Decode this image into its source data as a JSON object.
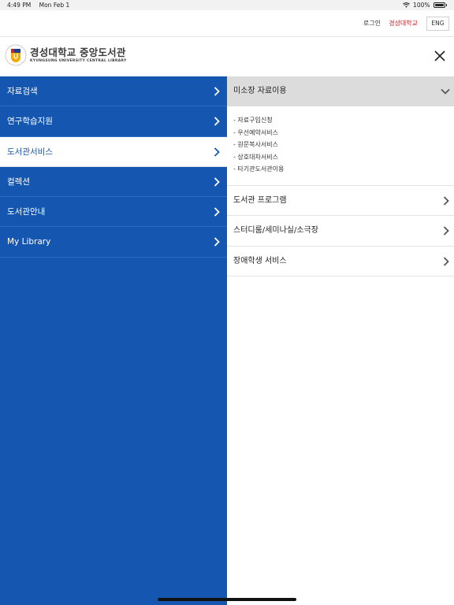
{
  "status_bar": {
    "time": "4:49 PM",
    "date": "Mon Feb 1",
    "battery": "100%",
    "icons": [
      "wifi-icon",
      "battery-icon"
    ]
  },
  "util_bar": {
    "login": "로그인",
    "university": "경성대학교",
    "language": "ENG"
  },
  "header": {
    "logo_ko": "경성대학교 중앙도서관",
    "logo_en": "KYUNGSUNG UNIVERSITY  CENTRAL LIBRARY",
    "close_icon": "close-icon"
  },
  "left_nav": {
    "items": [
      {
        "label": "자료검색"
      },
      {
        "label": "연구학습지원"
      },
      {
        "label": "도서관서비스"
      },
      {
        "label": "컬렉션"
      },
      {
        "label": "도서관안내"
      },
      {
        "label": "My Library"
      }
    ],
    "active_index": 2
  },
  "right_panel": {
    "expanded": {
      "label": "미소장 자료이용",
      "items": [
        "- 자료구입신청",
        "- 우선예약서비스",
        "- 원문복사서비스",
        "- 상호대차서비스",
        "- 타기관도서관이용"
      ]
    },
    "rows": [
      {
        "label": "도서관 프로그램"
      },
      {
        "label": "스터디룸/세미나실/소극장"
      },
      {
        "label": "장애학생 서비스"
      }
    ]
  },
  "colors": {
    "primary": "#1557b0",
    "accent_red": "#c0272d",
    "expanded_bg": "#dcdcdc"
  }
}
